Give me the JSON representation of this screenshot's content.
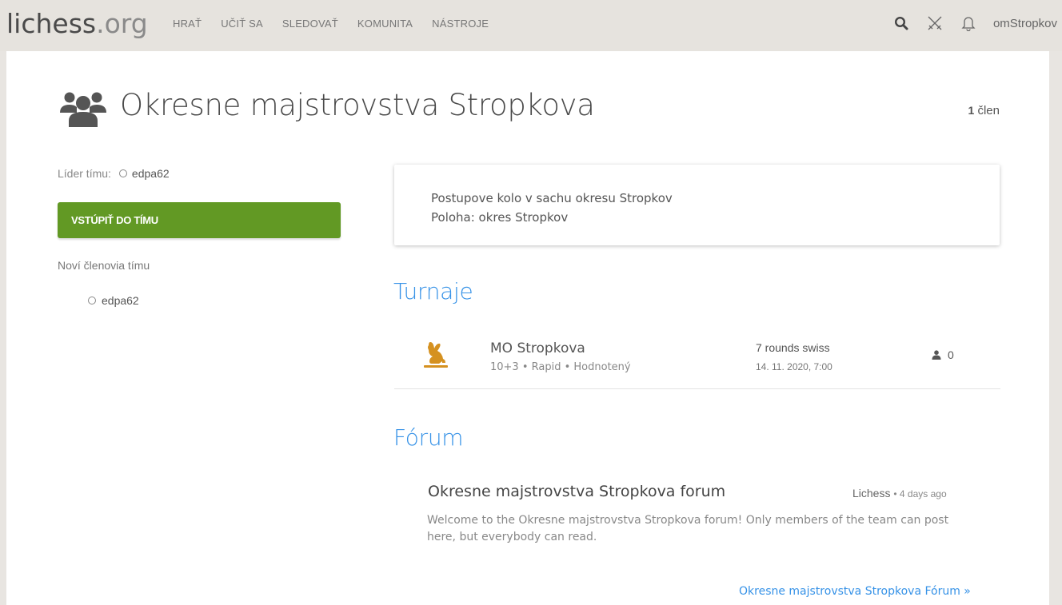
{
  "header": {
    "logo_main": "lichess",
    "logo_tld": ".org",
    "nav": [
      "HRAŤ",
      "UČIŤ SA",
      "SLEDOVAŤ",
      "KOMUNITA",
      "NÁSTROJE"
    ],
    "username": "omStropkov",
    "icons": [
      "search-icon",
      "swords-icon",
      "bell-icon"
    ]
  },
  "team": {
    "name": "Okresne majstrovstva Stropkova",
    "member_count": "1",
    "member_word": "člen",
    "leader_label": "Líder tímu:",
    "leader_name": "edpa62",
    "join_label": "VSTÚPIŤ DO TÍMU",
    "new_members_label": "Noví členovia tímu",
    "new_members": [
      "edpa62"
    ],
    "description": [
      "Postupove kolo v sachu okresu Stropkov",
      "Poloha: okres Stropkov"
    ]
  },
  "tournaments": {
    "title": "Turnaje",
    "items": [
      {
        "name": "MO Stropkova",
        "info": "10+3 • Rapid • Hodnotený",
        "format": "7 rounds swiss",
        "date": "14. 11. 2020, 7:00",
        "players": "0"
      }
    ]
  },
  "forum": {
    "title": "Fórum",
    "topic": "Okresne majstrovstva Stropkova forum",
    "author": "Lichess",
    "ago": "4 days ago",
    "excerpt": "Welcome to the Okresne majstrovstva Stropkova forum! Only members of the team can post here, but everybody can read.",
    "link": "Okresne majstrovstva Stropkova Fórum »"
  },
  "colors": {
    "accent": "#3692e7",
    "join_button": "#629924",
    "rabbit": "#d59120"
  }
}
